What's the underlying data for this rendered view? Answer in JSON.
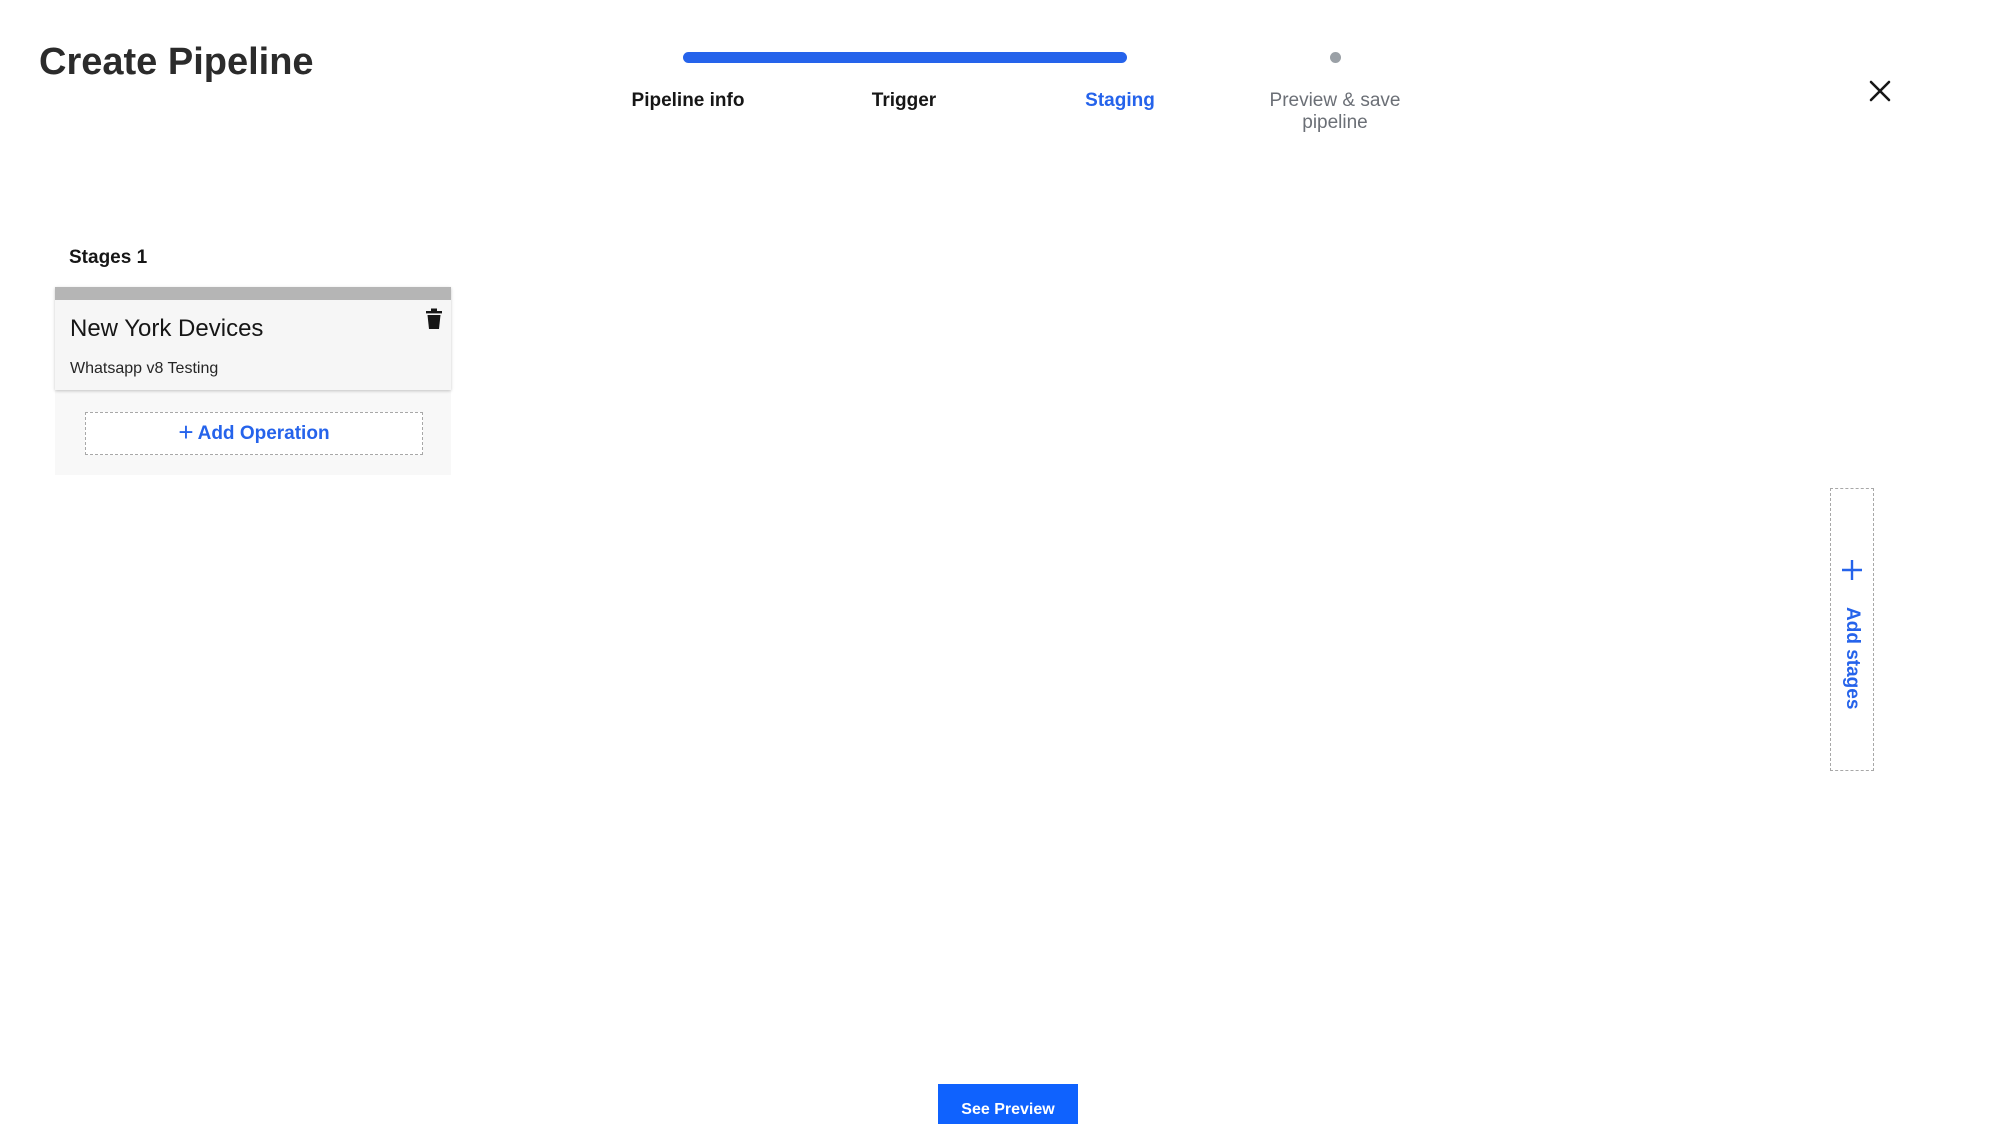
{
  "header": {
    "title": "Create Pipeline",
    "close_icon": "close-icon"
  },
  "stepper": {
    "progress": 0.75,
    "steps": [
      {
        "label": "Pipeline info",
        "state": "complete"
      },
      {
        "label": "Trigger",
        "state": "complete"
      },
      {
        "label": "Staging",
        "state": "current"
      },
      {
        "label": "Preview & save pipeline",
        "state": "upcoming"
      }
    ]
  },
  "stages": {
    "heading": "Stages 1",
    "items": [
      {
        "title": "New York Devices",
        "subtitle": "Whatsapp v8 Testing",
        "delete_icon": "trash-icon"
      }
    ],
    "add_operation_label": "Add Operation",
    "add_stages_label": "Add stages"
  },
  "footer": {
    "next_label": "See Preview"
  },
  "colors": {
    "accent": "#2563eb",
    "primary_button": "#0f62fe",
    "card_topbar": "#b5b5b5"
  }
}
